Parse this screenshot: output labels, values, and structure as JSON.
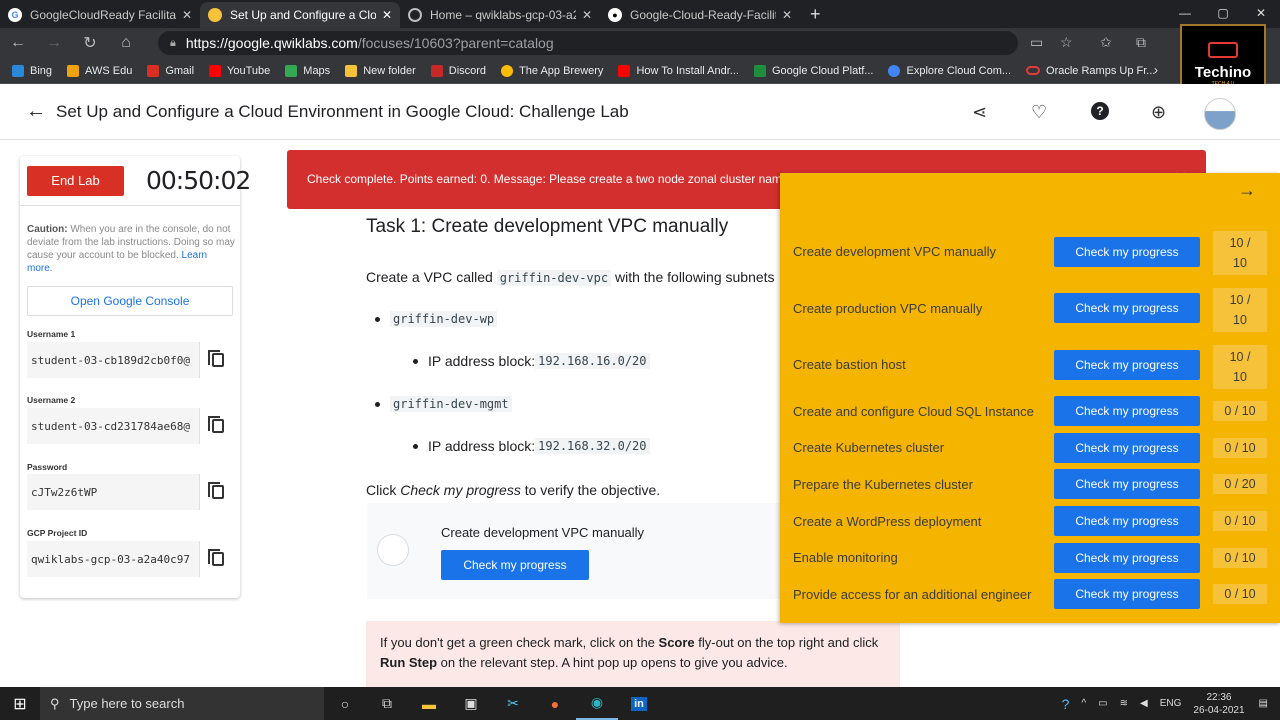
{
  "browser": {
    "tabs": [
      {
        "title": "GoogleCloudReady Facilitator Pr",
        "icon": "google-icon",
        "active": false
      },
      {
        "title": "Set Up and Configure a Cloud En",
        "icon": "qwiklabs-icon",
        "active": true
      },
      {
        "title": "Home – qwiklabs-gcp-03-a2a...",
        "icon": "cloud-icon",
        "active": false
      },
      {
        "title": "Google-Cloud-Ready-Facilitator/",
        "icon": "github-icon",
        "active": false
      }
    ],
    "url_scheme": "https://",
    "url_domain": "google.qwiklabs.com",
    "url_path": "/focuses/10603?parent=catalog",
    "bookmarks": [
      {
        "label": "Bing",
        "color": "#2b88d8"
      },
      {
        "label": "AWS Edu",
        "color": "#f0a30a"
      },
      {
        "label": "Gmail",
        "color": "#d93025"
      },
      {
        "label": "YouTube",
        "color": "#ff0000"
      },
      {
        "label": "Maps",
        "color": "#34a853"
      },
      {
        "label": "New folder",
        "color": "#f6c23a"
      },
      {
        "label": "Discord",
        "color": "#c62828"
      },
      {
        "label": "The App Brewery",
        "color": "#fbbc05"
      },
      {
        "label": "How To Install Andr...",
        "color": "#ff0000"
      },
      {
        "label": "Google Cloud Platf...",
        "color": "#1e8e3e"
      },
      {
        "label": "Explore Cloud Com...",
        "color": "#4285f4"
      },
      {
        "label": "Oracle Ramps Up Fr...",
        "color": "#e53935"
      }
    ]
  },
  "watermark": {
    "title": "Techino",
    "subtitle": "TECH 4 U"
  },
  "header": {
    "title": "Set Up and Configure a Cloud Environment in Google Cloud: Challenge Lab"
  },
  "lab": {
    "end_label": "End Lab",
    "timer": "00:50:02",
    "caution_bold": "Caution:",
    "caution_text": " When you are in the console, do not deviate from the lab instructions. Doing so may cause your account to be blocked.",
    "learn_more": "Learn more.",
    "open_console": "Open Google Console",
    "fields": [
      {
        "label": "Username 1",
        "value": "student-03-cb189d2cb0f0@"
      },
      {
        "label": "Username 2",
        "value": "student-03-cd231784ae68@"
      },
      {
        "label": "Password",
        "value": "cJTw2z6tWP"
      },
      {
        "label": "GCP Project ID",
        "value": "qwiklabs-gcp-03-a2a40c97"
      }
    ]
  },
  "banner": {
    "message": "Check complete. Points earned: 0. Message: Please create a two node zonal cluster named griffin-dev in the griffin-dev-wp subnet."
  },
  "task": {
    "heading": "Task 1: Create development VPC manually",
    "intro_pre": "Create a VPC called ",
    "intro_code": "griffin-dev-vpc",
    "intro_post": " with the following subnets",
    "subnet1": "griffin-dev-wp",
    "subnet1_ip_label": "IP address block: ",
    "subnet1_ip": "192.168.16.0/20",
    "subnet2": "griffin-dev-mgmt",
    "subnet2_ip_label": "IP address block: ",
    "subnet2_ip": "192.168.32.0/20",
    "click_pre": "Click ",
    "click_em": "Check my progress",
    "click_post": " to verify the objective.",
    "card_title": "Create development VPC manually",
    "card_button": "Check my progress",
    "hint_a": "If you don't get a green check mark, click on the ",
    "hint_b": "Score",
    "hint_c": " fly-out on the top right and click ",
    "hint_d": "Run Step",
    "hint_e": " on the relevant step. A hint pop up opens to give you advice."
  },
  "score": {
    "button_label": "Check my progress",
    "rows": [
      {
        "label": "Create development VPC manually",
        "points": "10 / 10"
      },
      {
        "label": "Create production VPC manually",
        "points": "10 / 10"
      },
      {
        "label": "Create bastion host",
        "points": "10 / 10"
      },
      {
        "label": "Create and configure Cloud SQL Instance",
        "points": "0 / 10"
      },
      {
        "label": "Create Kubernetes cluster",
        "points": "0 / 10"
      },
      {
        "label": "Prepare the Kubernetes cluster",
        "points": "0 / 20"
      },
      {
        "label": "Create a WordPress deployment",
        "points": "0 / 10"
      },
      {
        "label": "Enable monitoring",
        "points": "0 / 10"
      },
      {
        "label": "Provide access for an additional engineer",
        "points": "0 / 10"
      }
    ]
  },
  "taskbar": {
    "search_placeholder": "Type here to search",
    "lang": "ENG",
    "time": "22:36",
    "date": "26-04-2021"
  }
}
